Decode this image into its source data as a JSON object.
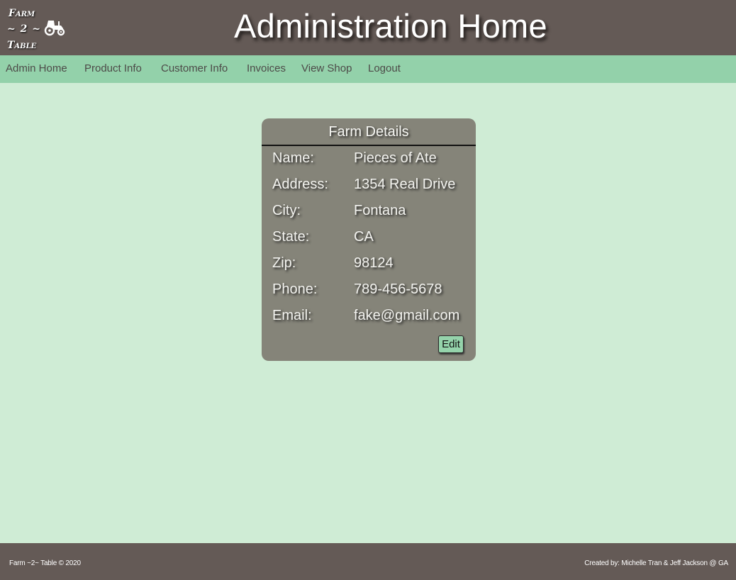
{
  "header": {
    "logo": {
      "line1": "Farm",
      "line2": "~ 2 ~",
      "line3": "Table",
      "icon": "tractor-icon"
    },
    "title": "Administration Home"
  },
  "nav": {
    "items": [
      {
        "label": "Admin Home"
      },
      {
        "label": "Product Info"
      },
      {
        "label": "Customer Info"
      },
      {
        "label": "Invoices"
      },
      {
        "label": "View Shop"
      },
      {
        "label": "Logout"
      }
    ]
  },
  "farm_details": {
    "title": "Farm Details",
    "rows": [
      {
        "label": "Name:",
        "value": "Pieces of Ate"
      },
      {
        "label": "Address:",
        "value": "1354 Real Drive"
      },
      {
        "label": "City:",
        "value": "Fontana"
      },
      {
        "label": "State:",
        "value": "CA"
      },
      {
        "label": "Zip:",
        "value": "98124"
      },
      {
        "label": "Phone:",
        "value": "789-456-5678"
      },
      {
        "label": "Email:",
        "value": "fake@gmail.com"
      }
    ],
    "edit_label": "Edit"
  },
  "footer": {
    "left": "Farm ~2~ Table © 2020",
    "right": "Created by: Michelle Tran & Jeff Jackson @ GA"
  },
  "colors": {
    "header_bg": "#645a56",
    "nav_bg": "#93d1aa",
    "page_bg": "#cfecd5",
    "card_bg": "#858479",
    "button_bg": "#95d3ab"
  }
}
